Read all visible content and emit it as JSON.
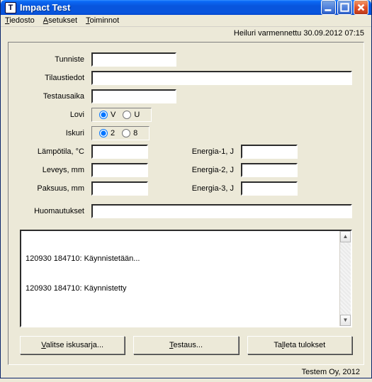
{
  "window": {
    "title": "Impact Test",
    "appicon_letter": "T"
  },
  "menu": {
    "file": "Tiedosto",
    "settings": "Asetukset",
    "actions": "Toiminnot"
  },
  "status": "Heiluri varmennettu 30.09.2012 07:15",
  "labels": {
    "tunniste": "Tunniste",
    "tilaustiedot": "Tilaustiedot",
    "testausaika": "Testausaika",
    "lovi": "Lovi",
    "iskuri": "Iskuri",
    "lampotila": "Lämpötila, °C",
    "leveys": "Leveys, mm",
    "paksuus": "Paksuus, mm",
    "energia1": "Energia-1, J",
    "energia2": "Energia-2, J",
    "energia3": "Energia-3, J",
    "huomautukset": "Huomautukset"
  },
  "fields": {
    "tunniste": "",
    "tilaustiedot": "",
    "testausaika": "",
    "lampotila": "",
    "leveys": "",
    "paksuus": "",
    "energia1": "",
    "energia2": "",
    "energia3": "",
    "huomautukset": ""
  },
  "lovi": {
    "options": [
      "V",
      "U"
    ],
    "selected": "V"
  },
  "iskuri": {
    "options": [
      "2",
      "8"
    ],
    "selected": "2"
  },
  "log": [
    "120930 184710: Käynnistetään...",
    "120930 184710: Käynnistetty"
  ],
  "buttons": {
    "valitse": "Valitse iskusarja...",
    "testaus": "Testaus...",
    "talleta": "Talleta tulokset"
  },
  "footer": "Testem Oy, 2012"
}
